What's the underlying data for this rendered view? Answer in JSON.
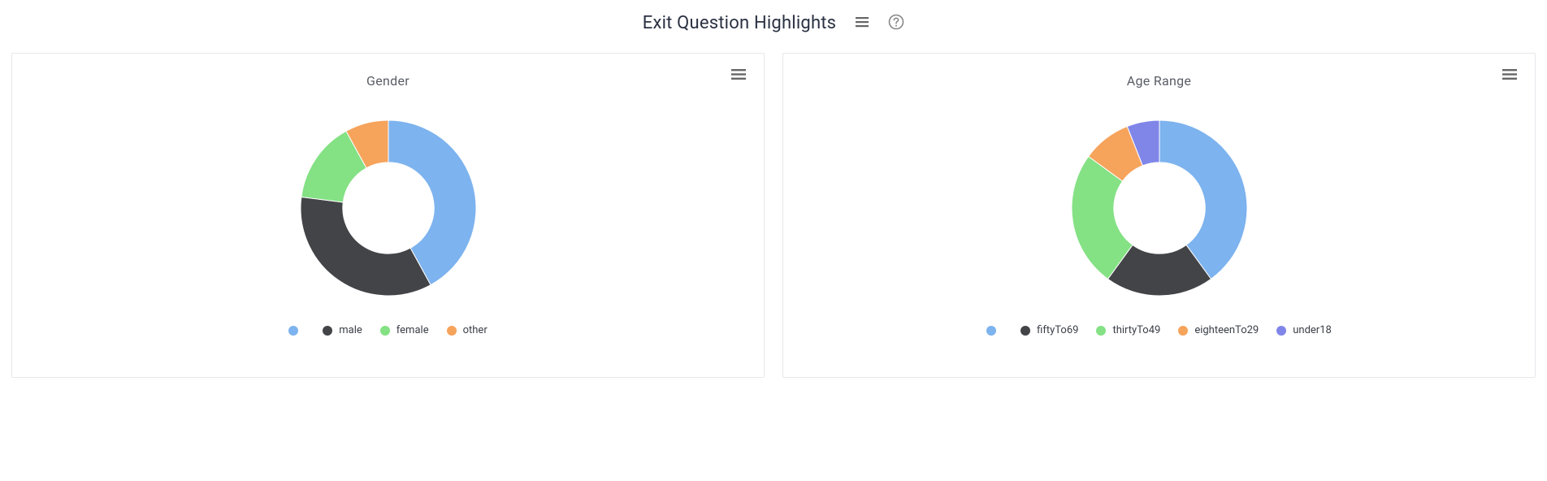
{
  "header": {
    "title": "Exit Question Highlights"
  },
  "colors": {
    "blue": "#7db3ee",
    "dark": "#434448",
    "green": "#84e184",
    "orange": "#f6a35c",
    "purple": "#8086e8"
  },
  "charts": [
    {
      "id": "gender",
      "title": "Gender",
      "legend": [
        {
          "label": "",
          "colorKey": "blue"
        },
        {
          "label": "male",
          "colorKey": "dark"
        },
        {
          "label": "female",
          "colorKey": "green"
        },
        {
          "label": "other",
          "colorKey": "orange"
        }
      ]
    },
    {
      "id": "ageRange",
      "title": "Age Range",
      "legend": [
        {
          "label": "",
          "colorKey": "blue"
        },
        {
          "label": "fiftyTo69",
          "colorKey": "dark"
        },
        {
          "label": "thirtyTo49",
          "colorKey": "green"
        },
        {
          "label": "eighteenTo29",
          "colorKey": "orange"
        },
        {
          "label": "under18",
          "colorKey": "purple"
        }
      ]
    }
  ],
  "chart_data": [
    {
      "type": "pie",
      "title": "Gender",
      "series": [
        {
          "name": "",
          "value": 42,
          "colorKey": "blue"
        },
        {
          "name": "male",
          "value": 35,
          "colorKey": "dark"
        },
        {
          "name": "female",
          "value": 15,
          "colorKey": "green"
        },
        {
          "name": "other",
          "value": 8,
          "colorKey": "orange"
        }
      ],
      "donut_inner_radius_pct": 52
    },
    {
      "type": "pie",
      "title": "Age Range",
      "series": [
        {
          "name": "",
          "value": 40,
          "colorKey": "blue"
        },
        {
          "name": "fiftyTo69",
          "value": 20,
          "colorKey": "dark"
        },
        {
          "name": "thirtyTo49",
          "value": 25,
          "colorKey": "green"
        },
        {
          "name": "eighteenTo29",
          "value": 9,
          "colorKey": "orange"
        },
        {
          "name": "under18",
          "value": 6,
          "colorKey": "purple"
        }
      ],
      "donut_inner_radius_pct": 52
    }
  ]
}
